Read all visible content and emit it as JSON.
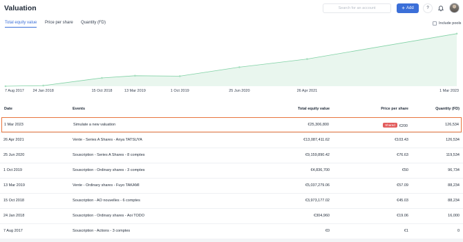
{
  "header": {
    "title": "Valuation",
    "search_placeholder": "Search for an account",
    "add_label": "Add",
    "help_label": "?"
  },
  "tabs": [
    {
      "label": "Total equity value",
      "active": true
    },
    {
      "label": "Price per share",
      "active": false
    },
    {
      "label": "Quantity (FD)",
      "active": false
    }
  ],
  "include_pools_label": "Include pools",
  "chart_data": {
    "type": "area",
    "x": [
      "7 Aug 2017",
      "24 Jan 2018",
      "15 Oct 2018",
      "13 Mar 2019",
      "1 Oct 2019",
      "25 Jun 2020",
      "26 Apr 2021",
      "1 Mar 2023"
    ],
    "values": [
      0,
      304960,
      3973177.02,
      5037279.06,
      4836700,
      9159890.42,
      13087411.62,
      25306800
    ],
    "xlabel": "",
    "ylabel": "",
    "grid": false,
    "colors": {
      "line": "#7fd1a4",
      "fill": "#e9f6ee",
      "point": "#a7dfbf"
    }
  },
  "table": {
    "headers": {
      "date": "Date",
      "events": "Events",
      "total": "Total equity value",
      "price": "Price per share",
      "quantity": "Quantity (FD)"
    },
    "rows": [
      {
        "date": "1 Mar 2023",
        "event": "Simulate a new valuation",
        "total": "€25,306,800",
        "badge": "Shared",
        "price": "€200",
        "quantity": "126,534"
      },
      {
        "date": "26 Apr 2021",
        "event": "Vente - Series A Shares - Anya TATSUYA",
        "total": "€13,087,411.62",
        "badge": "",
        "price": "€103.43",
        "quantity": "126,534"
      },
      {
        "date": "25 Jun 2020",
        "event": "Souscription - Series A Shares - 8 comptes",
        "total": "€9,159,890.42",
        "badge": "",
        "price": "€76.63",
        "quantity": "119,534"
      },
      {
        "date": "1 Oct 2019",
        "event": "Souscription - Ordinary shares - 3 comptes",
        "total": "€4,836,700",
        "badge": "",
        "price": "€50",
        "quantity": "96,734"
      },
      {
        "date": "13 Mar 2019",
        "event": "Vente - Ordinary shares - Fuyo TAKAMI",
        "total": "€5,037,279.06",
        "badge": "",
        "price": "€57.09",
        "quantity": "88,234"
      },
      {
        "date": "15 Oct 2018",
        "event": "Souscription - AO nouvelles - 6 comptes",
        "total": "€3,973,177.02",
        "badge": "",
        "price": "€45.03",
        "quantity": "88,234"
      },
      {
        "date": "24 Jan 2018",
        "event": "Souscription - Ordinary shares - Aoi TODO",
        "total": "€304,960",
        "badge": "",
        "price": "€19.06",
        "quantity": "16,000"
      },
      {
        "date": "7 Aug 2017",
        "event": "Souscription - Actions - 3 comptes",
        "total": "€0",
        "badge": "",
        "price": "€1",
        "quantity": "0"
      }
    ]
  }
}
